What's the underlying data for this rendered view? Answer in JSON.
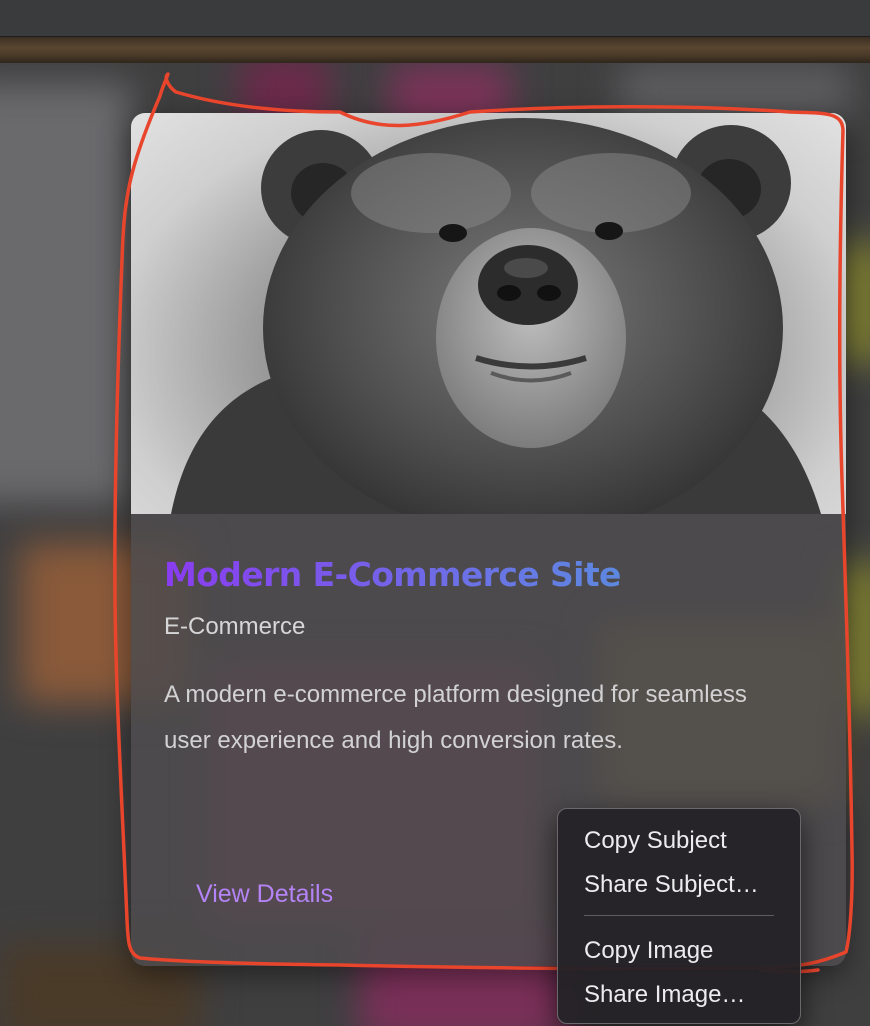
{
  "card": {
    "title": "Modern E-Commerce Site",
    "category": "E-Commerce",
    "description": "A modern e-commerce platform designed for seamless user experience and high conversion rates.",
    "link_label": "View Details",
    "image_subject": "bear-photo",
    "title_gradient": [
      "#8a3cf0",
      "#4aa6d8"
    ],
    "link_color": "#b483f5"
  },
  "context_menu": {
    "items": [
      {
        "label": "Copy Subject"
      },
      {
        "label": "Share Subject…"
      },
      {
        "label": "Copy Image"
      },
      {
        "label": "Share Image…"
      }
    ]
  },
  "annotation": {
    "color": "#e8452c"
  }
}
